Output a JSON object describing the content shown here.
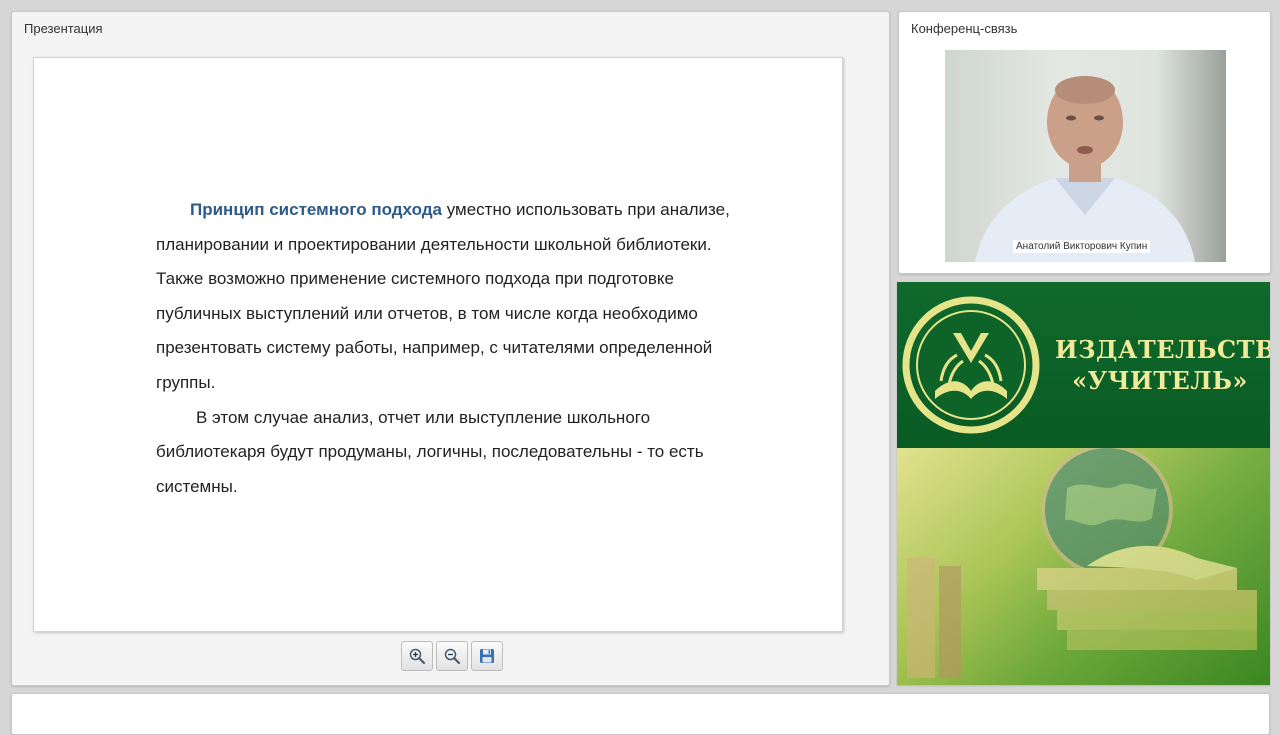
{
  "presentation": {
    "title": "Презентация",
    "slide": {
      "highlight": "Принцип системного подхода",
      "paragraph1_rest": " уместно использовать при анализе, планировании и проектировании деятельности школьной библиотеки. Также возможно применение системного подхода при подготовке публичных выступлений или отчетов, в том числе когда необходимо презентовать систему работы, например, с читателями определенной группы.",
      "paragraph2": "В этом случае анализ, отчет или выступление школьного библиотекаря  будут продуманы, логичны, последовательны - то есть системны."
    },
    "toolbar": {
      "zoom_in_icon": "zoom-in-icon",
      "zoom_out_icon": "zoom-out-icon",
      "save_icon": "floppy-disk-icon"
    }
  },
  "conference": {
    "title": "Конференц-связь",
    "speaker_name": "Анатолий Викторович Купин"
  },
  "ad": {
    "line1": "ИЗДАТЕЛЬСТВО",
    "line2": "«УЧИТЕЛЬ»",
    "colors": {
      "green": "#0f6a2c",
      "gold": "#f1ea9a",
      "lime": "#a8c23a"
    }
  }
}
